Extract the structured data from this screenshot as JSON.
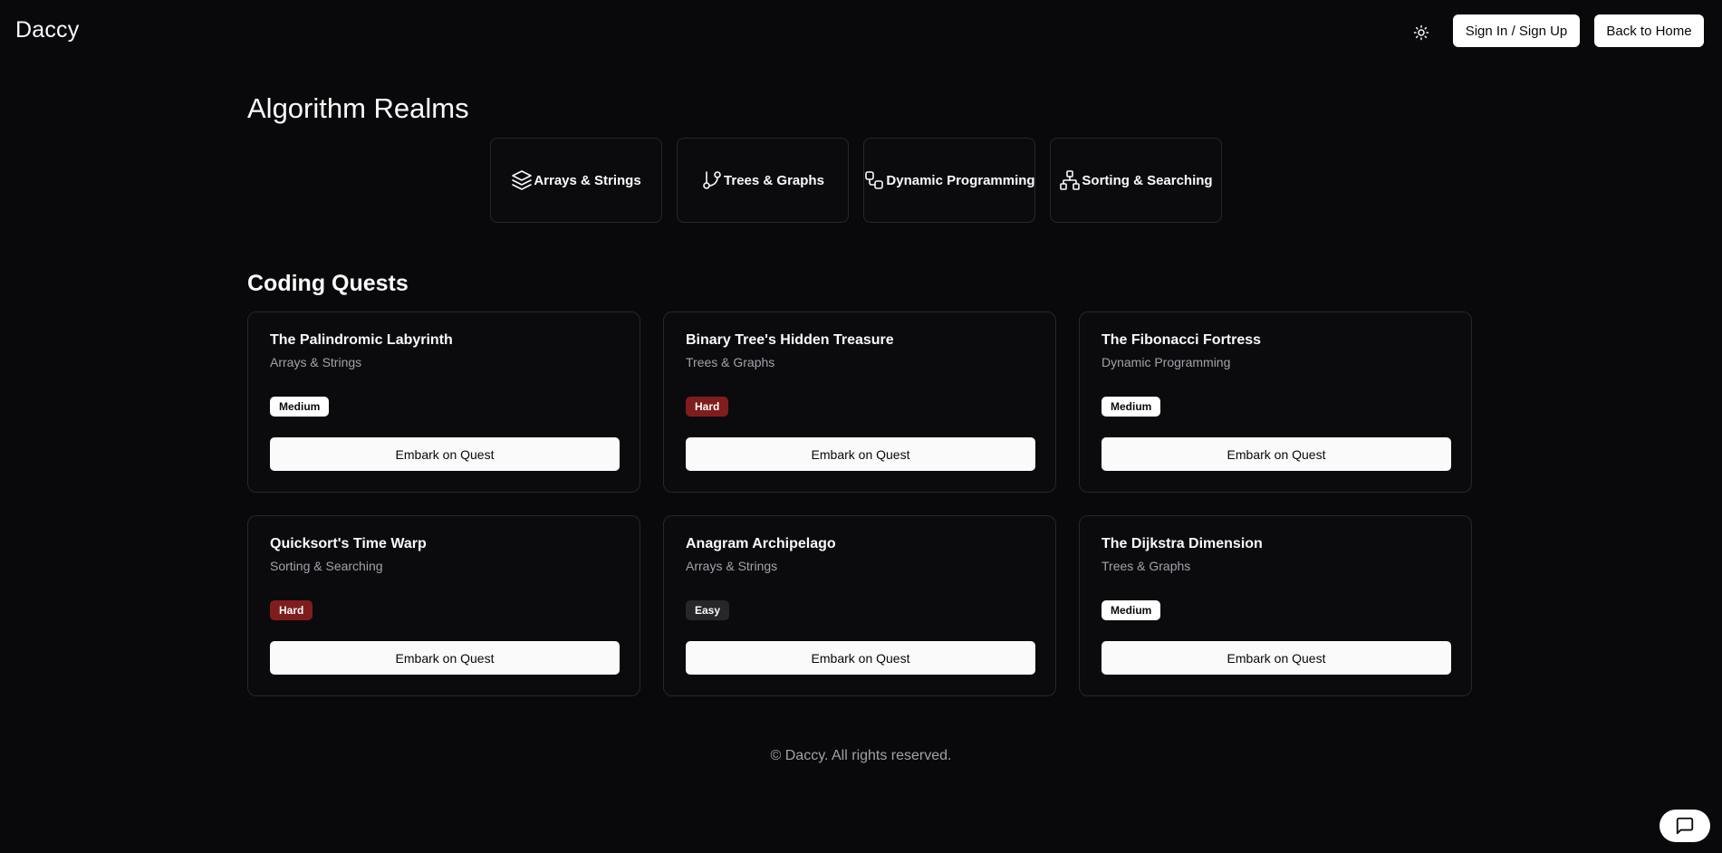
{
  "header": {
    "brand": "Daccy",
    "theme_icon": "sun-icon",
    "sign_in_label": "Sign In / Sign Up",
    "back_home_label": "Back to Home"
  },
  "realms": {
    "title": "Algorithm Realms",
    "items": [
      {
        "label": "Arrays & Strings",
        "icon": "layers-icon"
      },
      {
        "label": "Trees & Graphs",
        "icon": "git-branch-icon"
      },
      {
        "label": "Dynamic Programming",
        "icon": "workflow-icon"
      },
      {
        "label": "Sorting & Searching",
        "icon": "network-icon"
      }
    ]
  },
  "quests": {
    "title": "Coding Quests",
    "items": [
      {
        "title": "The Palindromic Labyrinth",
        "category": "Arrays & Strings",
        "difficulty": "Medium",
        "action": "Embark on Quest"
      },
      {
        "title": "Binary Tree's Hidden Treasure",
        "category": "Trees & Graphs",
        "difficulty": "Hard",
        "action": "Embark on Quest"
      },
      {
        "title": "The Fibonacci Fortress",
        "category": "Dynamic Programming",
        "difficulty": "Medium",
        "action": "Embark on Quest"
      },
      {
        "title": "Quicksort's Time Warp",
        "category": "Sorting & Searching",
        "difficulty": "Hard",
        "action": "Embark on Quest"
      },
      {
        "title": "Anagram Archipelago",
        "category": "Arrays & Strings",
        "difficulty": "Easy",
        "action": "Embark on Quest"
      },
      {
        "title": "The Dijkstra Dimension",
        "category": "Trees & Graphs",
        "difficulty": "Medium",
        "action": "Embark on Quest"
      }
    ]
  },
  "footer": {
    "text": "© Daccy. All rights reserved."
  },
  "chat": {
    "icon": "message-square-icon"
  },
  "colors": {
    "background": "#09090b",
    "card_border": "#27272a",
    "hard_badge": "#7f1d1d",
    "easy_badge": "#27272a",
    "muted_text": "#a1a1aa"
  }
}
